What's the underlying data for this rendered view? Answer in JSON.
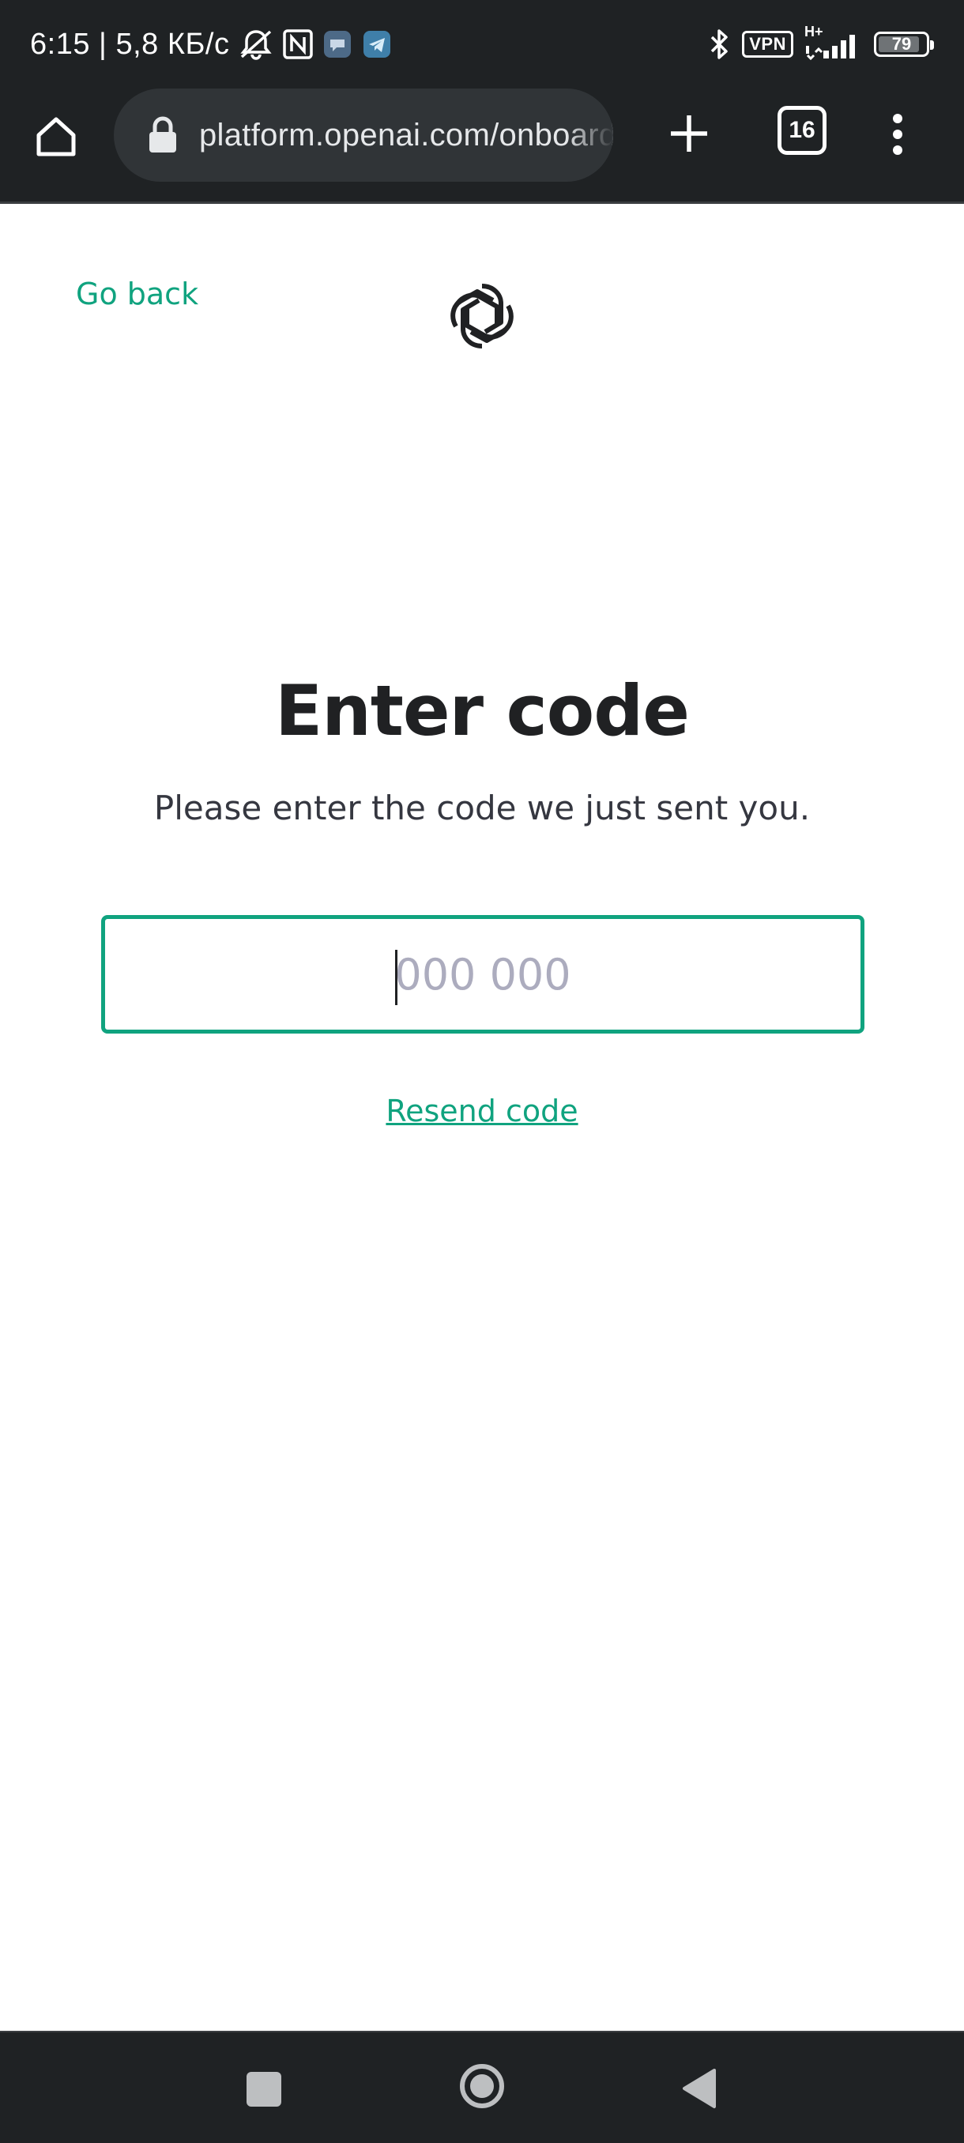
{
  "status_bar": {
    "time_speed": "6:15 | 5,8 КБ/с",
    "network_label": "H+",
    "vpn_label": "VPN",
    "battery_level": "79",
    "icons": [
      "muted-notifications-icon",
      "nfc-icon",
      "app-notification-icon",
      "telegram-icon",
      "bluetooth-icon",
      "vpn-icon",
      "signal-icon",
      "battery-icon"
    ]
  },
  "browser": {
    "url": "platform.openai.com/onboarding",
    "tab_count": "16",
    "icons": [
      "home-icon",
      "lock-icon",
      "plus-icon",
      "tabs-icon",
      "more-vert-icon"
    ]
  },
  "page": {
    "go_back": "Go back",
    "title": "Enter code",
    "subtitle": "Please enter the code we just sent you.",
    "code_input": {
      "placeholder": "000 000",
      "value": ""
    },
    "resend": "Resend code",
    "logo": "openai-logo"
  },
  "nav_bar": {
    "icons": [
      "recents-icon",
      "home-circle-icon",
      "back-triangle-icon"
    ]
  },
  "colors": {
    "accent": "#10a37f",
    "title_text": "#202123",
    "chrome_bg": "#1f2224",
    "urlbar_bg": "#303437",
    "placeholder": "#acacbe"
  }
}
